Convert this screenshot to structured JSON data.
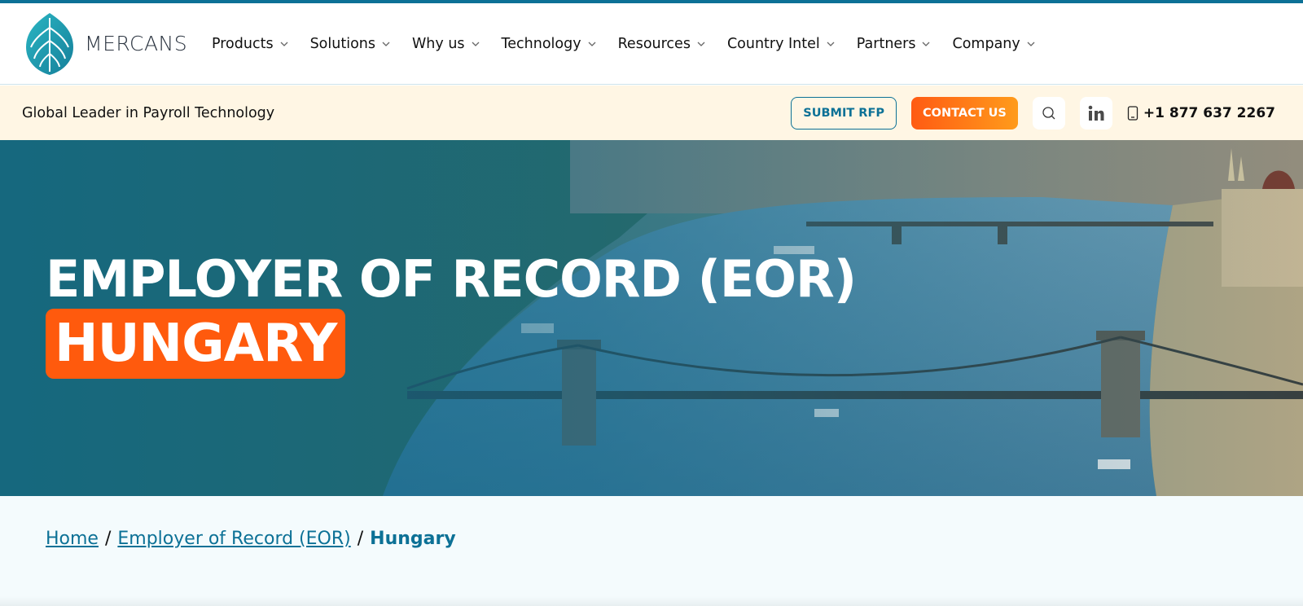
{
  "brand": {
    "name": "MERCANS",
    "accent": "#0c7196",
    "orange": "#ff5a0d"
  },
  "nav": {
    "items": [
      {
        "label": "Products"
      },
      {
        "label": "Solutions"
      },
      {
        "label": "Why us"
      },
      {
        "label": "Technology"
      },
      {
        "label": "Resources"
      },
      {
        "label": "Country Intel"
      },
      {
        "label": "Partners"
      },
      {
        "label": "Company"
      }
    ]
  },
  "subbar": {
    "tagline": "Global Leader in Payroll Technology",
    "submit_label": "SUBMIT RFP",
    "contact_label": "CONTACT US",
    "phone": "+1 877 637 2267",
    "icons": [
      "search-icon",
      "linkedin-icon",
      "phone-icon"
    ]
  },
  "hero": {
    "title": "EMPLOYER OF RECORD (EOR)",
    "country": "HUNGARY"
  },
  "breadcrumb": {
    "home": "Home",
    "sep": "/",
    "parent": "Employer of Record (EOR)",
    "current": "Hungary"
  }
}
